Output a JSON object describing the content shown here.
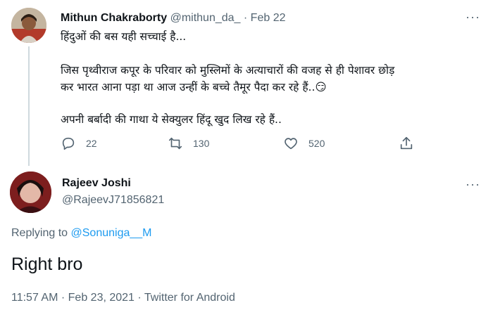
{
  "parent_tweet": {
    "author_name": "Mithun Chakraborty",
    "handle": "@mithun_da_",
    "separator": "·",
    "date": "Feb 22",
    "more": "···",
    "lines": [
      "हिंदुओं की बस यही सच्चाई है...",
      "जिस पृथ्वीराज कपूर के परिवार को मुस्लिमों के अत्याचारों की वजह से ही पेशावर छोड़",
      "कर भारत आना पड़ा था आज उन्हीं के बच्चे तैमूर पैदा कर रहे हैं..😏",
      "अपनी बर्बादी की गाथा ये सेक्युलर हिंदू खुद लिख रहे हैं.."
    ],
    "actions": {
      "reply_icon": "reply-icon",
      "reply_count": "22",
      "retweet_icon": "retweet-icon",
      "retweet_count": "130",
      "like_icon": "like-icon",
      "like_count": "520",
      "share_icon": "share-icon"
    }
  },
  "reply_tweet": {
    "author_name": "Rajeev Joshi",
    "handle": "@RajeevJ71856821",
    "more": "···",
    "replying_prefix": "Replying to",
    "replying_to": "@Sonuniga__M",
    "text": "Right bro",
    "time": "11:57 AM",
    "sep1": "·",
    "date": "Feb 23, 2021",
    "sep2": "·",
    "source": "Twitter for Android"
  },
  "colors": {
    "text": "#0f1419",
    "muted": "#536471",
    "link": "#1d9bf0",
    "thread_line": "#cfd9de"
  }
}
